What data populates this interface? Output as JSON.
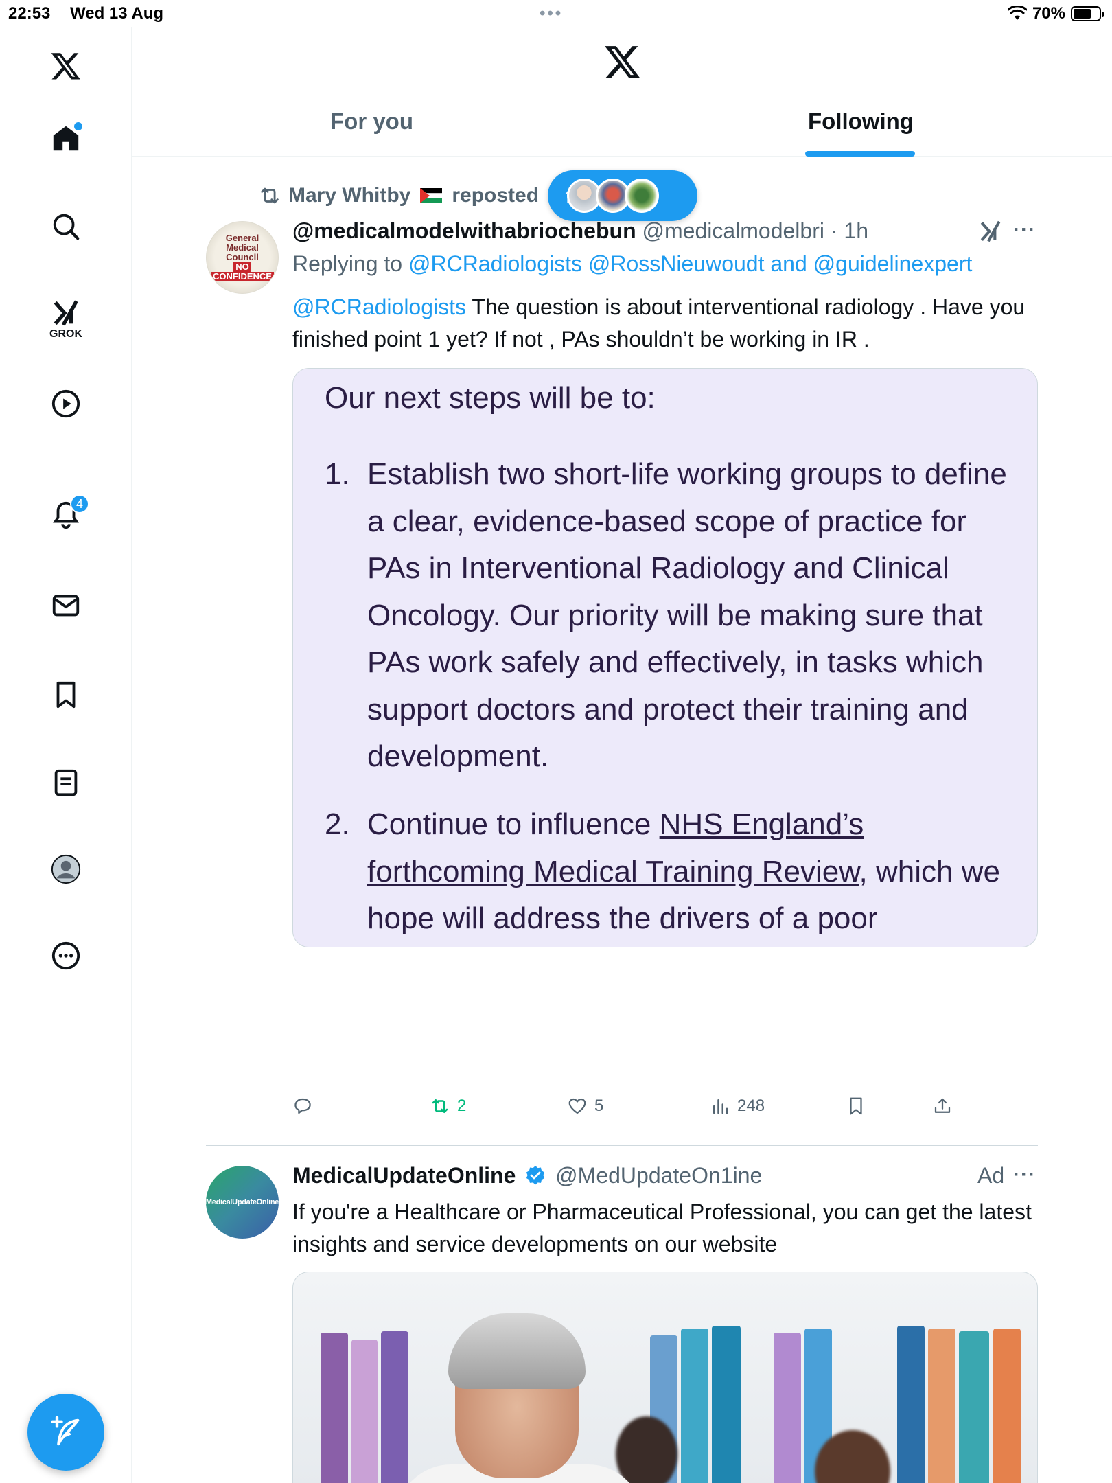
{
  "status_bar": {
    "time": "22:53",
    "date": "Wed 13 Aug",
    "battery": "70%",
    "battery_level": 0.7
  },
  "sidebar": {
    "items": [
      {
        "name": "x-logo-icon"
      },
      {
        "name": "home-icon",
        "notification_dot": true
      },
      {
        "name": "search-icon"
      },
      {
        "name": "grok-icon",
        "label": "GROK"
      },
      {
        "name": "video-icon"
      },
      {
        "name": "notifications-icon",
        "badge": "4"
      },
      {
        "name": "messages-icon"
      },
      {
        "name": "bookmarks-icon"
      },
      {
        "name": "lists-icon"
      },
      {
        "name": "profile-icon"
      },
      {
        "name": "more-icon"
      }
    ],
    "compose_icon": "compose-post-icon"
  },
  "header": {
    "tabs": [
      {
        "label": "For you",
        "active": false
      },
      {
        "label": "Following",
        "active": true
      }
    ]
  },
  "colors": {
    "accent": "#1d9bf0",
    "repost_green": "#00ba7c",
    "secondary_text": "#536471",
    "card_background": "#edeafa"
  },
  "posts": [
    {
      "repost_by": "Mary Whitby",
      "repost_suffix": "reposted",
      "display_name": "@medicalmodelwithabriochebun",
      "handle": "@medicalmodelbri",
      "time": "· 1h",
      "replying_prefix": "Replying to",
      "replying_to": "@RCRadiologists @RossNieuwoudt and @guidelinexpert",
      "mention": "@RCRadiologists",
      "text": " The question is about interventional radiology . Have you finished point 1 yet? If not , PAs shouldn’t be working in IR .",
      "avatar_lines": [
        "General",
        "Medical",
        "Council",
        "NO",
        "CONFIDENCE"
      ],
      "image": {
        "heading": "Our next steps will be to:",
        "items": [
          {
            "num": "1.",
            "text": "Establish two short-life working groups to define a clear, evidence-based scope of practice for PAs in Interventional Radiology and Clinical Oncology. Our priority will be making sure that PAs work safely and effectively, in tasks which support doctors and protect their training and development."
          },
          {
            "num": "2.",
            "text_before": "Continue to influence ",
            "link_text": "NHS England’s forthcoming Medical Training Review",
            "text_after": ", which we hope will address the drivers of a poor experience of specialty training. We understand this will be published in the autumn."
          }
        ]
      },
      "actions": {
        "reply_count": "",
        "repost_count": "2",
        "like_count": "5",
        "view_count": "248"
      }
    },
    {
      "display_name": "MedicalUpdateOnline",
      "verified": true,
      "handle": "@MedUpdateOn1ine",
      "ad_label": "Ad",
      "text": "If you're a Healthcare or Pharmaceutical Professional, you can get the latest insights and service developments on our website",
      "avatar_text": "MedicalUpdateOnline"
    }
  ]
}
